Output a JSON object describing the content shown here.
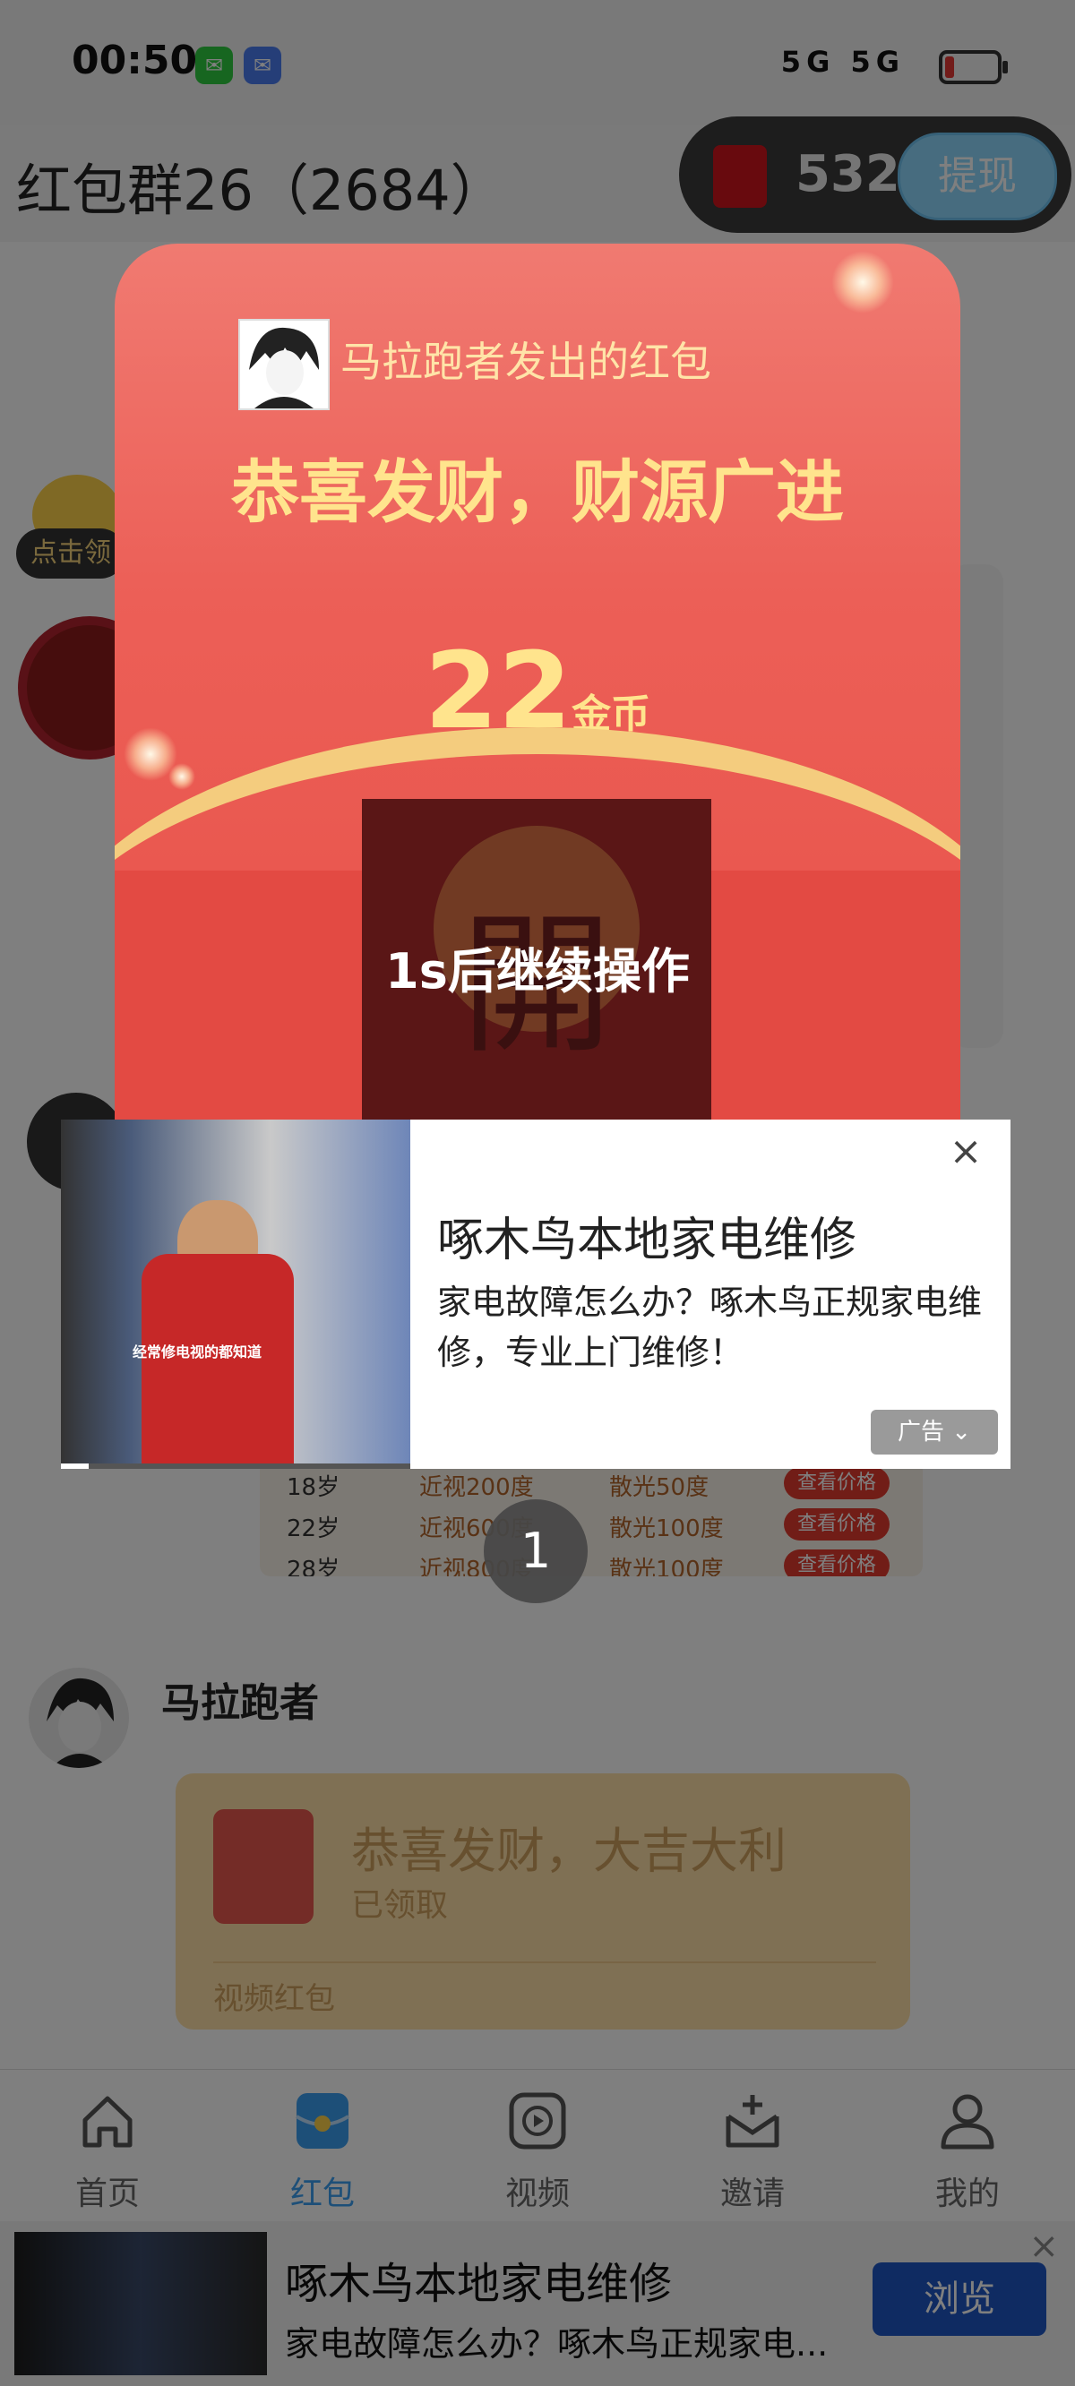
{
  "status_bar": {
    "time": "00:50",
    "network": "5G 5G"
  },
  "header": {
    "group_title": "红包群26（2684）",
    "coin_value": "5322",
    "withdraw_label": "提现"
  },
  "side": {
    "claim_tag": "点击领"
  },
  "price_table": {
    "rows": [
      {
        "age": "18岁",
        "myopia": "近视200度",
        "astig": "散光50度",
        "btn": "查看价格"
      },
      {
        "age": "22岁",
        "myopia": "近视600度",
        "astig": "散光100度",
        "btn": "查看价格"
      },
      {
        "age": "28岁",
        "myopia": "近视800度",
        "astig": "散光100度",
        "btn": "查看价格"
      }
    ]
  },
  "chat": {
    "sender": "马拉跑者",
    "bubble_title": "恭喜发财，大吉大利",
    "bubble_status": "已领取",
    "bubble_footer": "视频红包"
  },
  "tabbar": {
    "tabs": [
      {
        "label": "首页",
        "icon": "home-icon"
      },
      {
        "label": "红包",
        "icon": "red-packet-icon",
        "active": true
      },
      {
        "label": "视频",
        "icon": "video-icon"
      },
      {
        "label": "邀请",
        "icon": "invite-icon"
      },
      {
        "label": "我的",
        "icon": "profile-icon"
      }
    ],
    "active_color": "#3b9ef0"
  },
  "envelope": {
    "sender_text": "马拉跑者发出的红包",
    "blessing": "恭喜发财，财源广进",
    "amount": "22",
    "amount_unit": "金币",
    "open_char": "開",
    "countdown_text": "1s后继续操作"
  },
  "ad_popup": {
    "title": "啄木鸟本地家电维修",
    "description": "家电故障怎么办？啄木鸟正规家电维修，专业上门维修！",
    "badge": "广告",
    "video_caption": "经常修电视的都知道",
    "video_progress": 0.08
  },
  "countdown_circle": "1",
  "banner_ad": {
    "title": "啄木鸟本地家电维修",
    "description": "家电故障怎么办？啄木鸟正规家电...",
    "button": "浏览"
  },
  "colors": {
    "envelope_red": "#e85249",
    "gold_text": "#ffe48d",
    "browse_button": "#1f57c4"
  }
}
